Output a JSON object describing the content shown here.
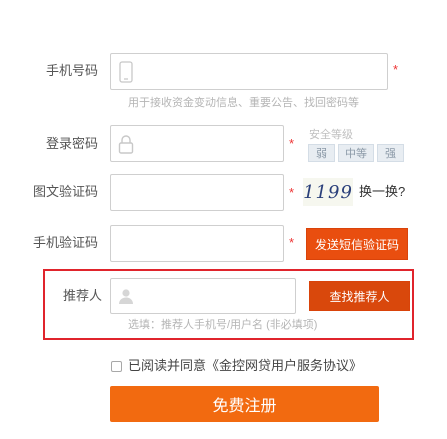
{
  "phone": {
    "label": "手机号码",
    "hint": "用于接收资金变动信息、重要公告、找回密码等",
    "required": "*"
  },
  "password": {
    "label": "登录密码",
    "required": "*",
    "strength_title": "安全等级",
    "levels": [
      "弱",
      "中等",
      "强"
    ]
  },
  "image_captcha": {
    "label": "图文验证码",
    "required": "*",
    "code": "1199",
    "refresh": "换一换?"
  },
  "sms_captcha": {
    "label": "手机验证码",
    "required": "*",
    "send_button": "发送短信验证码"
  },
  "referrer": {
    "label": "推荐人",
    "find_button": "查找推荐人",
    "hint": "选填：推荐人手机号/用户名 (非必填项)"
  },
  "agreement": {
    "text": "已阅读并同意《金控网贷用户服务协议》"
  },
  "register_button": "免费注册",
  "colors": {
    "accent": "#e94e0f",
    "highlight_border": "#e0242c"
  }
}
